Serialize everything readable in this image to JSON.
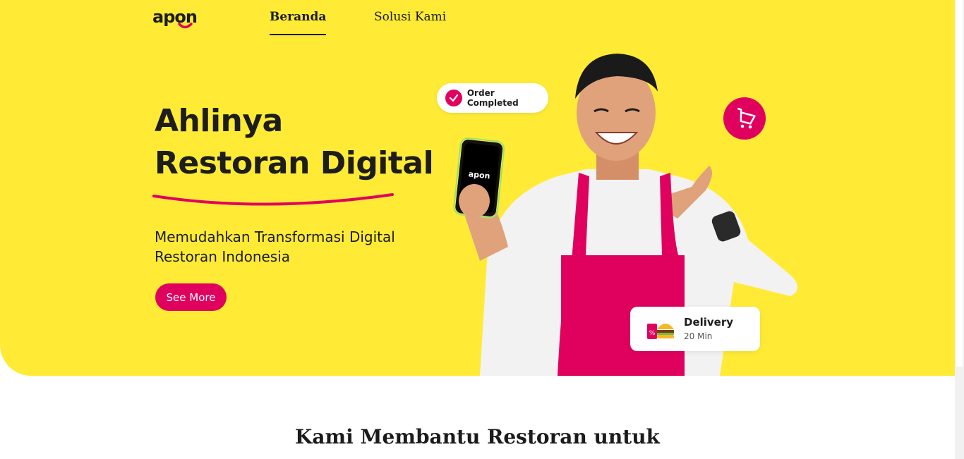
{
  "brand": {
    "logo_text": "apon",
    "primary_color": "#E0005E",
    "hero_bg_color": "#FFEB36"
  },
  "nav": {
    "items": [
      {
        "label": "Beranda",
        "active": true
      },
      {
        "label": "Solusi Kami",
        "active": false
      }
    ]
  },
  "hero": {
    "headline_line1": "Ahlinya",
    "headline_line2": "Restoran Digital",
    "subtitle": "Memudahkan Transformasi Digital Restoran Indonesia",
    "cta_label": "See More",
    "phone_logo_text": "apon",
    "order_chip_label": "Order Completed",
    "delivery_title": "Delivery",
    "delivery_time": "20 Min",
    "icons": [
      "check-icon",
      "shopping-cart-icon",
      "food-delivery-icon"
    ]
  },
  "section": {
    "title": "Kami Membantu Restoran untuk"
  }
}
